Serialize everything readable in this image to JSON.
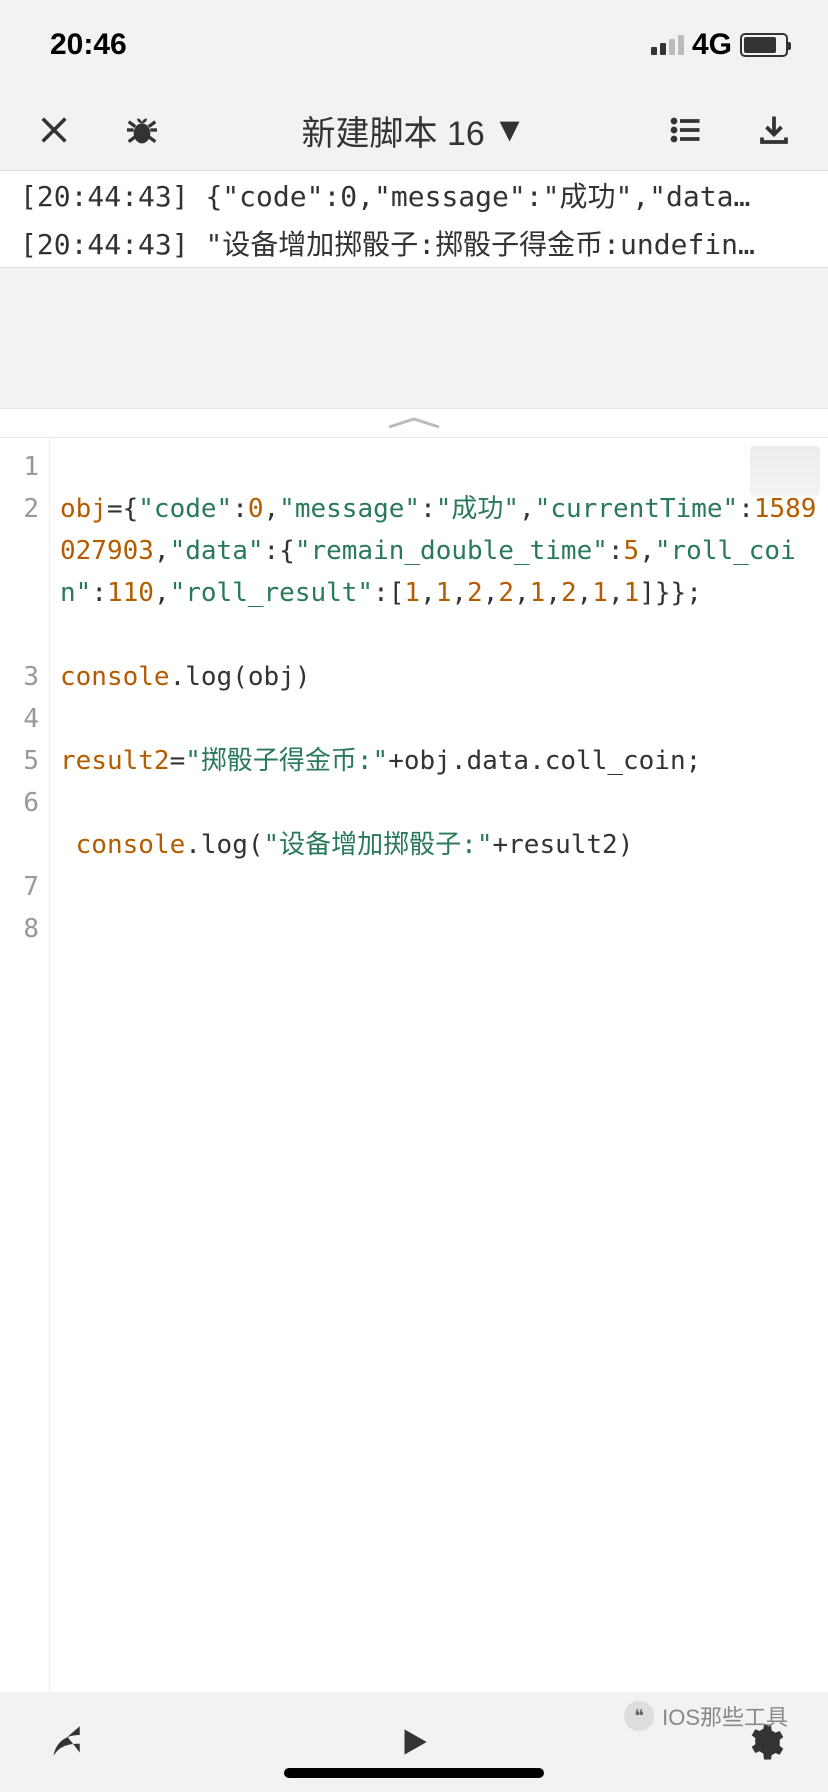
{
  "status": {
    "time": "20:46",
    "network": "4G"
  },
  "toolbar": {
    "title": "新建脚本 16"
  },
  "console": {
    "lines": [
      {
        "ts": "[20:44:43]",
        "text": "{\"code\":0,\"message\":\"成功\",\"data…"
      },
      {
        "ts": "[20:44:43]",
        "text": "\"设备增加掷骰子:掷骰子得金币:undefin…"
      }
    ]
  },
  "editor": {
    "gutter": [
      "1",
      "2",
      "",
      "",
      "",
      "3",
      "4",
      "5",
      "6",
      "",
      "7",
      "8"
    ],
    "code_lines": [
      {
        "n": 1,
        "tokens": []
      },
      {
        "n": 2,
        "tokens": [
          {
            "t": "ident",
            "v": "obj"
          },
          {
            "t": "punct",
            "v": "={"
          },
          {
            "t": "str",
            "v": "\"code\""
          },
          {
            "t": "punct",
            "v": ":"
          },
          {
            "t": "num",
            "v": "0"
          },
          {
            "t": "punct",
            "v": ","
          },
          {
            "t": "str",
            "v": "\"message\""
          },
          {
            "t": "punct",
            "v": ":"
          },
          {
            "t": "str",
            "v": "\"成功\""
          },
          {
            "t": "punct",
            "v": ","
          },
          {
            "t": "str",
            "v": "\"currentTime\""
          },
          {
            "t": "punct",
            "v": ":"
          },
          {
            "t": "num",
            "v": "1589027903"
          },
          {
            "t": "punct",
            "v": ","
          },
          {
            "t": "str",
            "v": "\"data\""
          },
          {
            "t": "punct",
            "v": ":{"
          },
          {
            "t": "str",
            "v": "\"remain_double_time\""
          },
          {
            "t": "punct",
            "v": ":"
          },
          {
            "t": "num",
            "v": "5"
          },
          {
            "t": "punct",
            "v": ","
          },
          {
            "t": "str",
            "v": "\"roll_coin\""
          },
          {
            "t": "punct",
            "v": ":"
          },
          {
            "t": "num",
            "v": "110"
          },
          {
            "t": "punct",
            "v": ","
          },
          {
            "t": "str",
            "v": "\"roll_result\""
          },
          {
            "t": "punct",
            "v": ":["
          },
          {
            "t": "num",
            "v": "1"
          },
          {
            "t": "punct",
            "v": ","
          },
          {
            "t": "num",
            "v": "1"
          },
          {
            "t": "punct",
            "v": ","
          },
          {
            "t": "num",
            "v": "2"
          },
          {
            "t": "punct",
            "v": ","
          },
          {
            "t": "num",
            "v": "2"
          },
          {
            "t": "punct",
            "v": ","
          },
          {
            "t": "num",
            "v": "1"
          },
          {
            "t": "punct",
            "v": ","
          },
          {
            "t": "num",
            "v": "2"
          },
          {
            "t": "punct",
            "v": ","
          },
          {
            "t": "num",
            "v": "1"
          },
          {
            "t": "punct",
            "v": ","
          },
          {
            "t": "num",
            "v": "1"
          },
          {
            "t": "punct",
            "v": "]}};"
          }
        ]
      },
      {
        "n": 3,
        "tokens": []
      },
      {
        "n": 4,
        "tokens": [
          {
            "t": "ident",
            "v": "console"
          },
          {
            "t": "punct",
            "v": "."
          },
          {
            "t": "method",
            "v": "log"
          },
          {
            "t": "punct",
            "v": "("
          },
          {
            "t": "kw",
            "v": "obj"
          },
          {
            "t": "punct",
            "v": ")"
          }
        ]
      },
      {
        "n": 5,
        "tokens": []
      },
      {
        "n": 6,
        "tokens": [
          {
            "t": "ident",
            "v": "result2"
          },
          {
            "t": "punct",
            "v": "="
          },
          {
            "t": "str",
            "v": "\"掷骰子得金币:\""
          },
          {
            "t": "punct",
            "v": "+obj.data.coll_coin;"
          }
        ]
      },
      {
        "n": 7,
        "tokens": []
      },
      {
        "n": 8,
        "tokens": [
          {
            "t": "punct",
            "v": " "
          },
          {
            "t": "ident",
            "v": "console"
          },
          {
            "t": "punct",
            "v": "."
          },
          {
            "t": "method",
            "v": "log"
          },
          {
            "t": "punct",
            "v": "("
          },
          {
            "t": "str",
            "v": "\"设备增加掷骰子:\""
          },
          {
            "t": "punct",
            "v": "+result2)"
          }
        ]
      }
    ]
  },
  "watermark": "IOS那些工具"
}
